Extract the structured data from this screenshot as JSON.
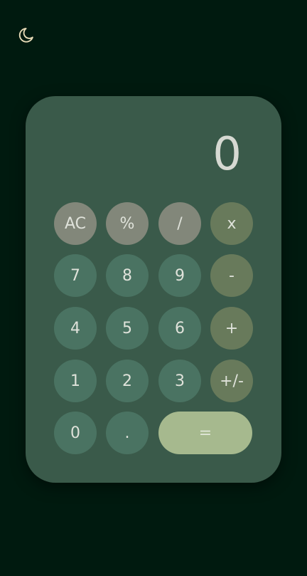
{
  "theme_toggle": {
    "icon": "moon-icon",
    "color": "#e8dcb8"
  },
  "display": {
    "value": "0"
  },
  "buttons": {
    "ac": "AC",
    "percent": "%",
    "divide": "/",
    "multiply": "x",
    "seven": "7",
    "eight": "8",
    "nine": "9",
    "subtract": "-",
    "four": "4",
    "five": "5",
    "six": "6",
    "add": "+",
    "one": "1",
    "two": "2",
    "three": "3",
    "negate": "+/-",
    "zero": "0",
    "decimal": ".",
    "equals": "="
  },
  "colors": {
    "background": "#001a0f",
    "panel": "#3a5a4a",
    "function_key": "#82877a",
    "operator_key": "#687a5b",
    "number_key": "#4a7362",
    "equals_key": "#a6b98e"
  }
}
